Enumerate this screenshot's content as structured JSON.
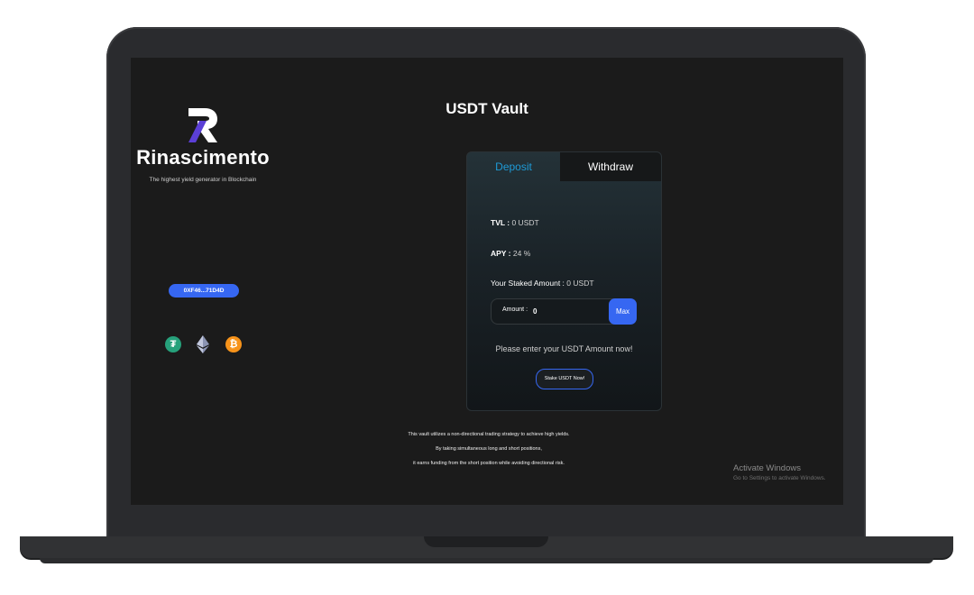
{
  "sidebar": {
    "brand": "Rinascimento",
    "tagline": "The highest yield generator in Blockchain",
    "wallet_address": "0XF46...71D4D",
    "coins": {
      "usdt_glyph": "₮",
      "btc_glyph": "₿"
    },
    "icons": [
      "rinascimento-logo-icon",
      "usdt-icon",
      "ethereum-icon",
      "bitcoin-icon"
    ]
  },
  "vault": {
    "title": "USDT Vault",
    "tabs": {
      "deposit": "Deposit",
      "withdraw": "Withdraw",
      "active": "Deposit"
    },
    "tvl_label": "TVL :",
    "tvl_value": "0 USDT",
    "apy_label": "APY :",
    "apy_value": "24 %",
    "staked_label": "Your Staked Amount :",
    "staked_value": "0 USDT",
    "amount_label": "Amount :",
    "amount_value": "0",
    "max_label": "Max",
    "prompt": "Please enter your USDT Amount now!",
    "stake_button": "Stake USDT Now!"
  },
  "description": {
    "line1": "This vault utilizes a non-directional trading strategy to achieve high yields.",
    "line2": "By taking simultaneous long and short positions,",
    "line3": "it earns funding from the short position while avoiding directional risk."
  },
  "watermark": {
    "title": "Activate Windows",
    "subtitle": "Go to Settings to activate Windows."
  },
  "colors": {
    "accent_blue": "#3667f2",
    "active_tab": "#1e9bd7",
    "screen_bg": "#1b1b1b",
    "usdt_green": "#26a17b",
    "btc_orange": "#f7931a"
  }
}
